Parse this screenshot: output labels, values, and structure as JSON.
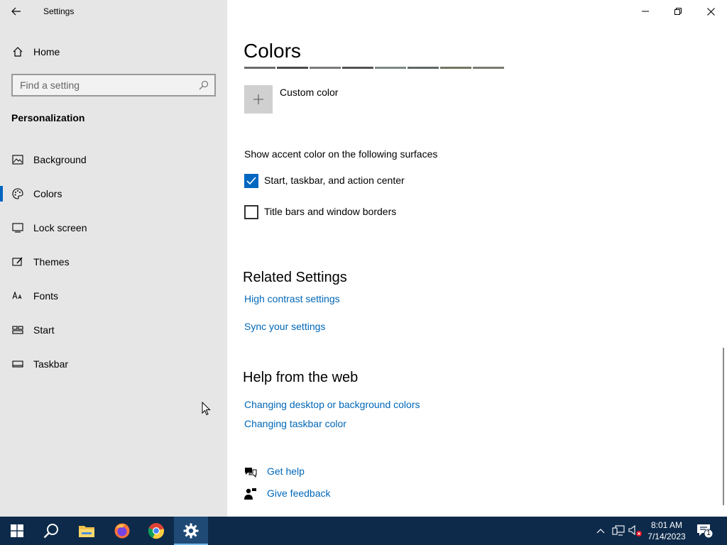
{
  "window": {
    "title": "Settings"
  },
  "sidebar": {
    "home_label": "Home",
    "search_placeholder": "Find a setting",
    "section_title": "Personalization",
    "items": [
      {
        "label": "Background",
        "icon": "picture-icon"
      },
      {
        "label": "Colors",
        "icon": "palette-icon",
        "active": true
      },
      {
        "label": "Lock screen",
        "icon": "lock-screen-icon"
      },
      {
        "label": "Themes",
        "icon": "themes-icon"
      },
      {
        "label": "Fonts",
        "icon": "fonts-icon"
      },
      {
        "label": "Start",
        "icon": "start-icon"
      },
      {
        "label": "Taskbar",
        "icon": "taskbar-icon"
      }
    ]
  },
  "main": {
    "title": "Colors",
    "swatch_colors": [
      "#6b6b6b",
      "#4a4a4a",
      "#7a7a7a",
      "#525252",
      "#7d8a84",
      "#5f6964",
      "#727760",
      "#7a7a72"
    ],
    "custom_color_label": "Custom color",
    "accent_heading": "Show accent color on the following surfaces",
    "checkboxes": [
      {
        "label": "Start, taskbar, and action center",
        "checked": true
      },
      {
        "label": "Title bars and window borders",
        "checked": false
      }
    ],
    "related_heading": "Related Settings",
    "related_links": [
      "High contrast settings",
      "Sync your settings"
    ],
    "help_heading": "Help from the web",
    "help_links": [
      "Changing desktop or background colors",
      "Changing taskbar color"
    ],
    "get_help": "Get help",
    "give_feedback": "Give feedback"
  },
  "taskbar": {
    "time": "8:01 AM",
    "date": "7/14/2023",
    "notification_count": "1",
    "accent_color": "#0d2a4a"
  }
}
